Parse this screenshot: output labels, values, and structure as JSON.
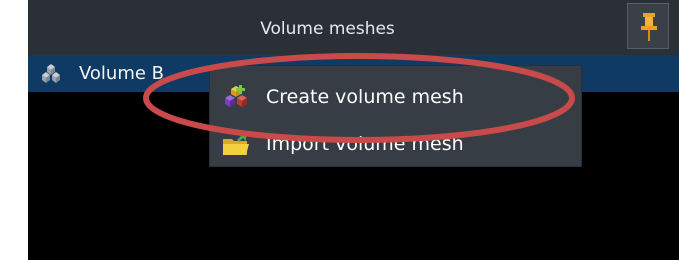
{
  "panel": {
    "title": "Volume meshes",
    "pin_icon": "pushpin-icon"
  },
  "tree": {
    "items": [
      {
        "label": "Volume B",
        "icon": "volume-mesh-icon",
        "selected": true
      }
    ]
  },
  "context_menu": {
    "items": [
      {
        "label": "Create volume mesh",
        "icon": "create-mesh-blocks-icon"
      },
      {
        "label": "Import volume mesh",
        "icon": "import-folder-icon"
      }
    ]
  },
  "colors": {
    "header_bg": "#2b3036",
    "selection_bg": "#0f3a64",
    "menu_bg": "#373d44",
    "highlight_ring": "#c94a4a",
    "pin": "#f0a020"
  }
}
